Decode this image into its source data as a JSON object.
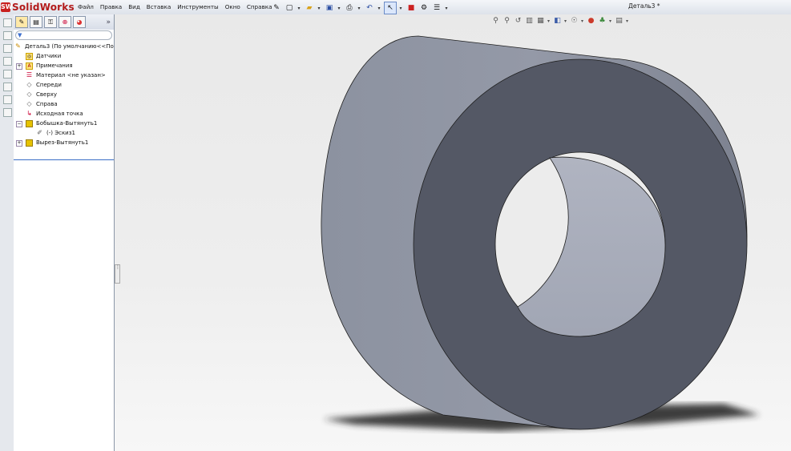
{
  "app": {
    "logo_text": "SolidWorks",
    "doc_title": "Деталь3 *"
  },
  "menu": [
    "Файл",
    "Правка",
    "Вид",
    "Вставка",
    "Инструменты",
    "Окно",
    "Справка"
  ],
  "quick_access": [
    "pin-icon",
    "new-icon",
    "open-icon",
    "save-icon",
    "print-icon",
    "undo-icon",
    "select-icon",
    "rebuild-icon",
    "options-icon",
    "customize-icon"
  ],
  "featuremanager": {
    "tabs": [
      "featuremanager-tab",
      "propertymanager-tab",
      "configuration-tab",
      "dimxpert-tab",
      "display-tab"
    ],
    "expand_glyph": "»",
    "filter_glyph": "▼",
    "tree": [
      {
        "label": "Деталь3  (По умолчанию<<По у",
        "icon": "part-icon"
      },
      {
        "label": "Датчики",
        "icon": "sensors-icon"
      },
      {
        "label": "Примечания",
        "icon": "annotations-icon",
        "expand": "+"
      },
      {
        "label": "Материал <не указан>",
        "icon": "material-icon"
      },
      {
        "label": "Спереди",
        "icon": "plane-icon"
      },
      {
        "label": "Сверху",
        "icon": "plane-icon"
      },
      {
        "label": "Справа",
        "icon": "plane-icon"
      },
      {
        "label": "Исходная точка",
        "icon": "origin-icon"
      },
      {
        "label": "Бобышка-Вытянуть1",
        "icon": "boss-extrude-icon",
        "expand": "−"
      },
      {
        "label": "(-) Эскиз1",
        "icon": "sketch-icon"
      },
      {
        "label": "Вырез-Вытянуть1",
        "icon": "cut-extrude-icon",
        "expand": "+"
      }
    ]
  },
  "viewport": {
    "heads_up_toolbar": [
      "zoom-to-fit-icon",
      "zoom-area-icon",
      "previous-view-icon",
      "section-view-icon",
      "view-orientation-icon",
      "display-style-icon",
      "hide-show-icon",
      "edit-appearance-icon",
      "apply-scene-icon",
      "view-settings-icon"
    ],
    "model": "hollow-cylinder",
    "colors": {
      "outer_face": "#8f95a3",
      "front_face": "#545865",
      "inner_bore": "#a3a8b6",
      "shadow": "#2b2b2b"
    }
  }
}
